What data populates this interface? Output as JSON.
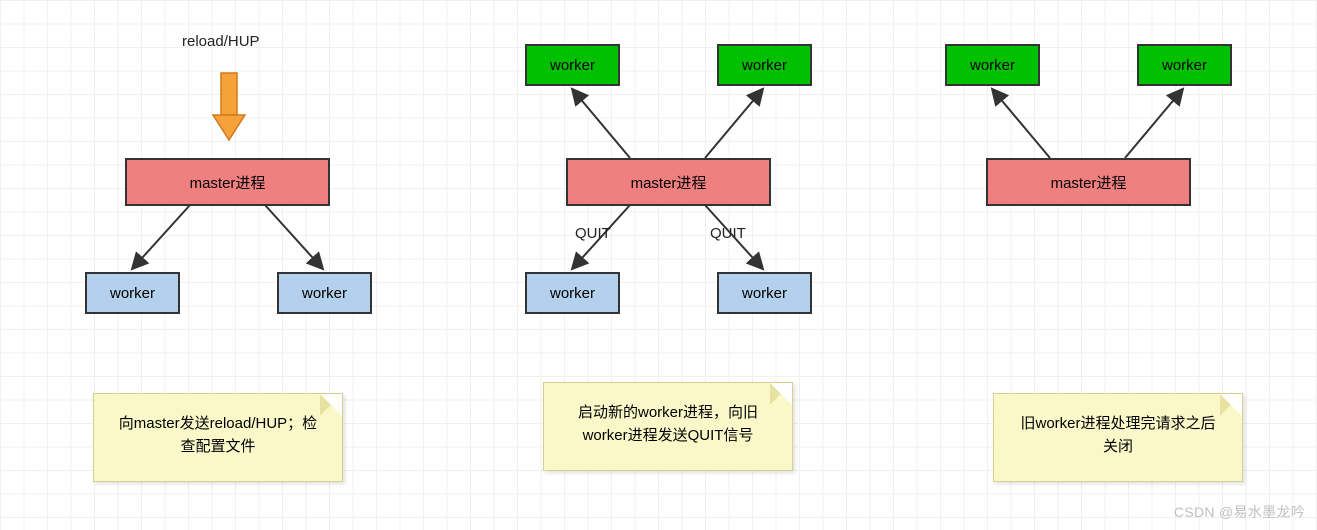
{
  "panel1": {
    "topLabel": "reload/HUP",
    "master": "master进程",
    "workerLeft": "worker",
    "workerRight": "worker",
    "note": "向master发送reload/HUP；检查配置文件"
  },
  "panel2": {
    "greenLeft": "worker",
    "greenRight": "worker",
    "master": "master进程",
    "quitLeft": "QUIT",
    "quitRight": "QUIT",
    "workerLeft": "worker",
    "workerRight": "worker",
    "note": "启动新的worker进程，向旧worker进程发送QUIT信号"
  },
  "panel3": {
    "greenLeft": "worker",
    "greenRight": "worker",
    "master": "master进程",
    "note": "旧worker进程处理完请求之后关闭"
  },
  "watermark": "CSDN @易水墨龙吟"
}
